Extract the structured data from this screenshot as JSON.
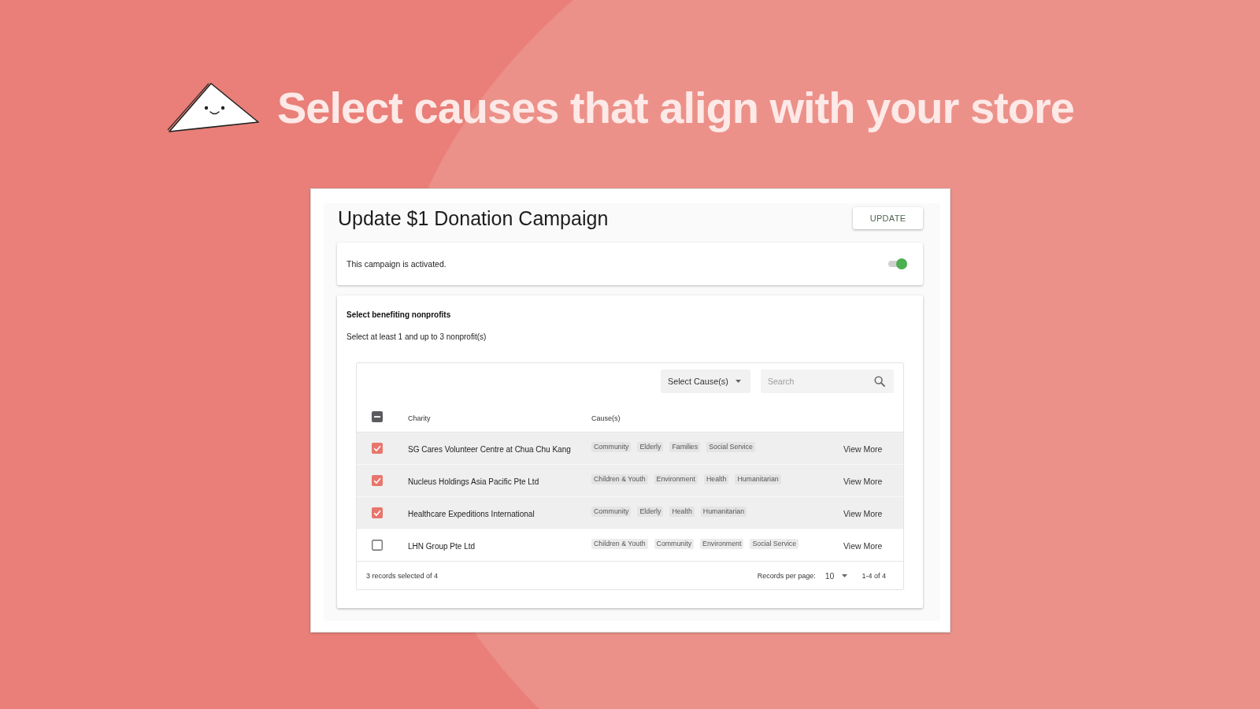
{
  "headline": "Select causes that align with your store",
  "campaign": {
    "title": "Update $1 Donation Campaign",
    "update_button": "UPDATE",
    "activation": {
      "text": "This campaign is activated.",
      "on": true
    }
  },
  "nonprofits": {
    "title": "Select benefiting nonprofits",
    "instruction": "Select at least 1 and up to 3 nonprofit(s)",
    "cause_filter": {
      "label": "Select Cause(s)"
    },
    "search": {
      "placeholder": "Search"
    },
    "table": {
      "select_all": {
        "checked": false,
        "indeterminate": true
      },
      "columns": [
        "Charity",
        "Cause(s)"
      ],
      "rows": [
        {
          "charity": "SG Cares Volunteer Centre at Chua Chu Kang",
          "causes": [
            "Community",
            "Elderly",
            "Families",
            "Social Service"
          ],
          "link": "View More",
          "selected": true
        },
        {
          "charity": "Nucleus Holdings Asia Pacific Pte Ltd",
          "causes": [
            "Children & Youth",
            "Environment",
            "Health",
            "Humanitarian"
          ],
          "link": "View More",
          "selected": true
        },
        {
          "charity": "Healthcare Expeditions International",
          "causes": [
            "Community",
            "Elderly",
            "Health",
            "Humanitarian"
          ],
          "link": "View More",
          "selected": true
        },
        {
          "charity": "LHN Group Pte Ltd",
          "causes": [
            "Children & Youth",
            "Community",
            "Environment",
            "Social Service"
          ],
          "link": "View More",
          "selected": false
        }
      ],
      "footer": {
        "summary": "3 records selected of 4",
        "per_page_label": "Records per page:",
        "per_page": "10",
        "range": "1-4 of 4"
      }
    }
  }
}
